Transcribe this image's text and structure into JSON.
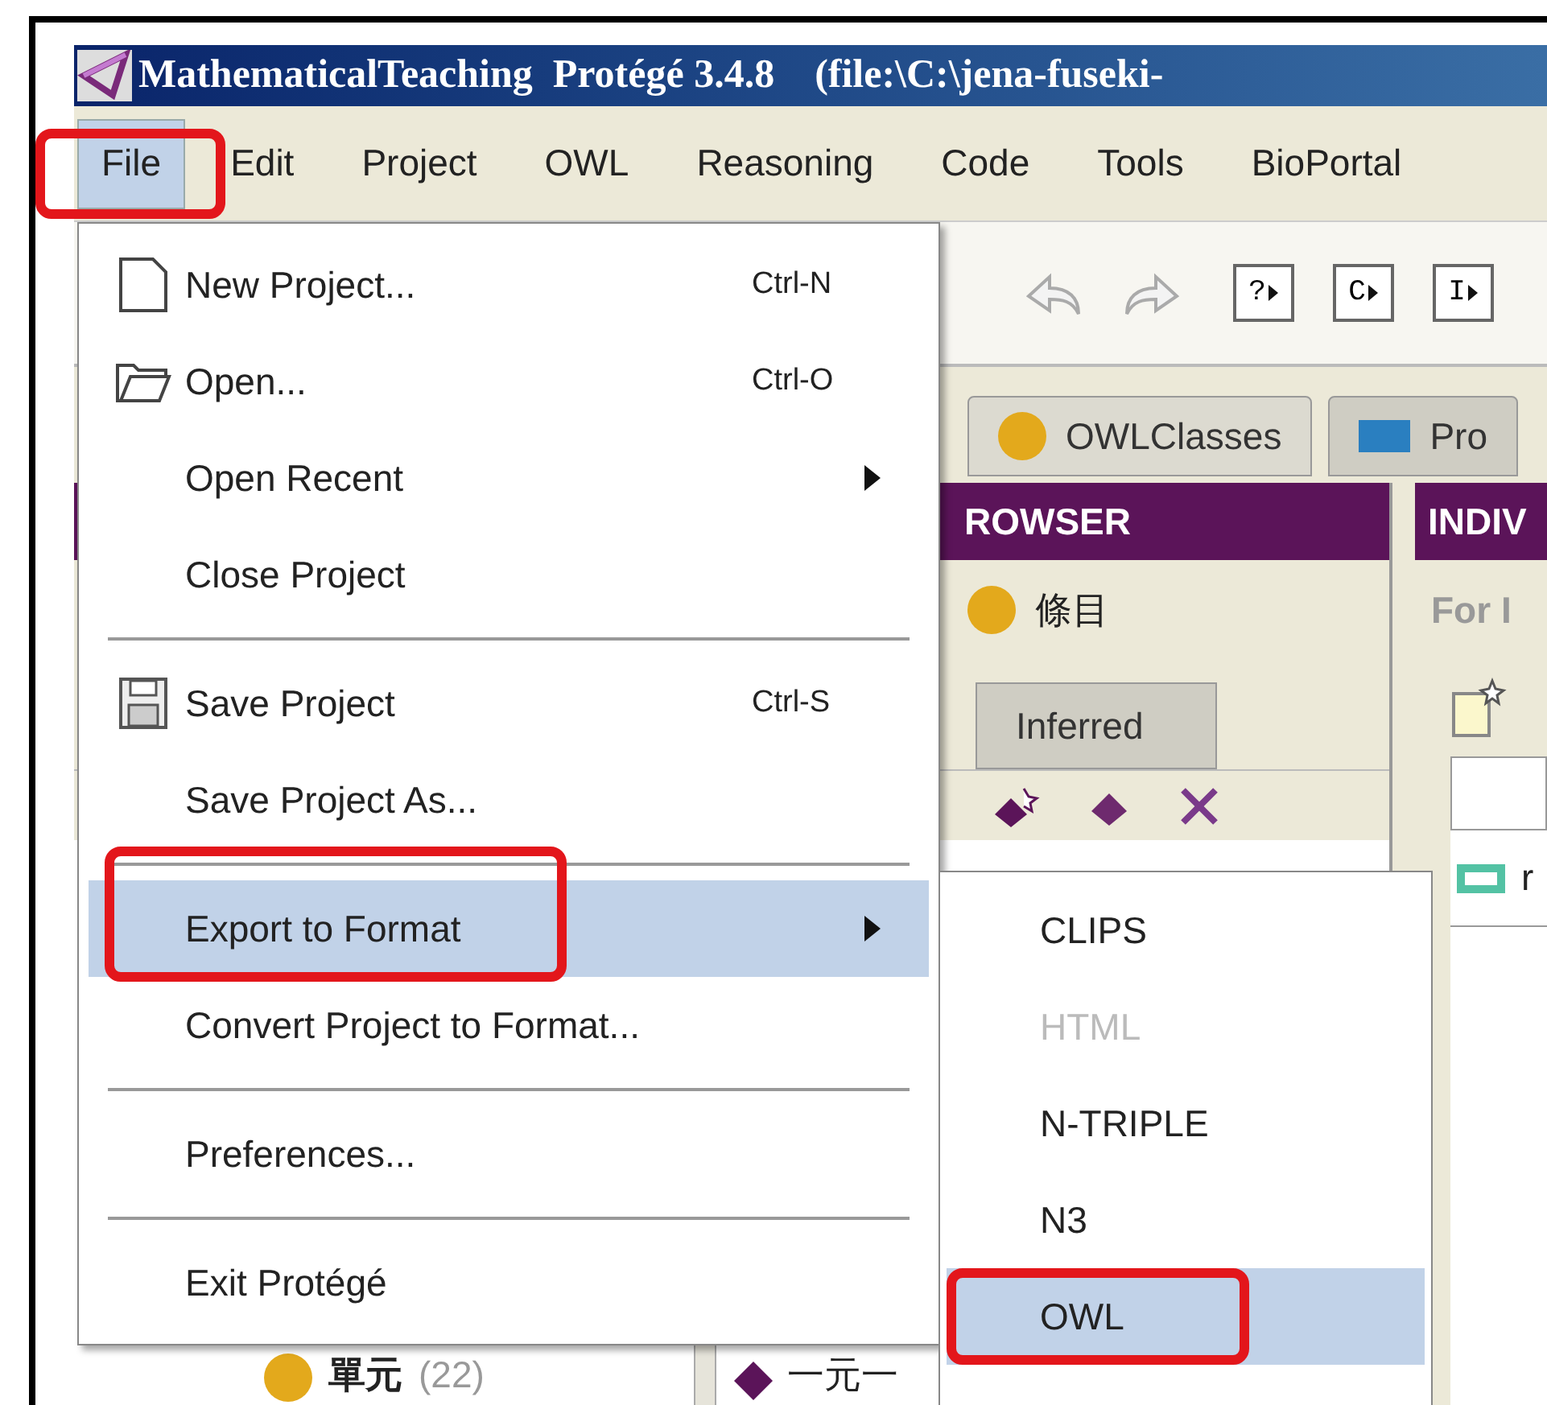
{
  "window": {
    "title": "MathematicalTeaching  Protégé 3.4.8    (file:\\C:\\jena-fuseki-"
  },
  "menubar": [
    {
      "label": "File",
      "selected": true,
      "highlighted": true
    },
    {
      "label": "Edit",
      "selected": false,
      "highlighted": false
    },
    {
      "label": "Project",
      "selected": false,
      "highlighted": false
    },
    {
      "label": "OWL",
      "selected": false,
      "highlighted": false
    },
    {
      "label": "Reasoning",
      "selected": false,
      "highlighted": false
    },
    {
      "label": "Code",
      "selected": false,
      "highlighted": false
    },
    {
      "label": "Tools",
      "selected": false,
      "highlighted": false
    },
    {
      "label": "BioPortal",
      "selected": false,
      "highlighted": false
    }
  ],
  "toolbar": {
    "query_buttons": [
      "?",
      "C",
      "I"
    ]
  },
  "tabs": [
    {
      "label": "OWLClasses",
      "kind": "class",
      "selected": true
    },
    {
      "label": "Pro",
      "kind": "property",
      "selected": false
    }
  ],
  "class_browser": {
    "header": "ROWSER",
    "root": "條目",
    "tabs": [
      {
        "label": "Inferred",
        "selected": false
      }
    ],
    "tree_item": {
      "label": "單元",
      "count": "(22)"
    },
    "hierarchy_item": "一元一"
  },
  "individuals": {
    "header": "INDIV",
    "caption": "For I",
    "items": [
      "r"
    ]
  },
  "file_menu": [
    {
      "kind": "document",
      "label": "New Project...",
      "shortcut": "Ctrl-N",
      "selected": false,
      "highlighted": false
    },
    {
      "kind": "folder",
      "label": "Open...",
      "shortcut": "Ctrl-O",
      "selected": false,
      "highlighted": false
    },
    {
      "kind": "submenu",
      "label": "Open Recent",
      "selected": false,
      "highlighted": false
    },
    {
      "kind": "item",
      "label": "Close Project",
      "selected": false,
      "highlighted": false
    },
    {
      "kind": "separator"
    },
    {
      "kind": "disk",
      "label": "Save Project",
      "shortcut": "Ctrl-S",
      "selected": false,
      "highlighted": false
    },
    {
      "kind": "item",
      "label": "Save Project As...",
      "selected": false,
      "highlighted": false
    },
    {
      "kind": "separator"
    },
    {
      "kind": "submenu",
      "label": "Export to Format",
      "selected": true,
      "highlighted": true
    },
    {
      "kind": "item",
      "label": "Convert Project to Format...",
      "selected": false,
      "highlighted": false
    },
    {
      "kind": "separator"
    },
    {
      "kind": "item",
      "label": "Preferences...",
      "selected": false,
      "highlighted": false
    },
    {
      "kind": "separator"
    },
    {
      "kind": "item",
      "label": "Exit Protégé",
      "selected": false,
      "highlighted": false
    }
  ],
  "export_submenu": [
    {
      "label": "CLIPS",
      "disabled": false,
      "selected": false,
      "highlighted": false
    },
    {
      "label": "HTML",
      "disabled": true,
      "selected": false,
      "highlighted": false
    },
    {
      "label": "N-TRIPLE",
      "disabled": false,
      "selected": false,
      "highlighted": false
    },
    {
      "label": "N3",
      "disabled": false,
      "selected": false,
      "highlighted": false
    },
    {
      "label": "OWL",
      "disabled": false,
      "selected": true,
      "highlighted": true
    }
  ]
}
